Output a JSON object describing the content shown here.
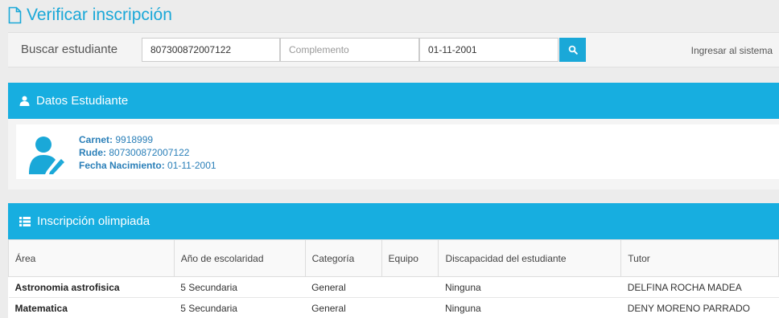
{
  "page": {
    "title": "Verificar inscripción"
  },
  "search": {
    "label": "Buscar estudiante",
    "ci_value": "807300872007122",
    "complement_placeholder": "Complemento",
    "date_value": "01-11-2001",
    "login_link": "Ingresar al sistema"
  },
  "student": {
    "panel_title": "Datos Estudiante",
    "carnet_label": "Carnet:",
    "carnet": "9918999",
    "rude_label": "Rude:",
    "rude": "807300872007122",
    "birth_label": "Fecha Nacimiento:",
    "birth": "01-11-2001"
  },
  "registration": {
    "panel_title": "Inscripción olimpiada",
    "columns": [
      "Área",
      "Año de escolaridad",
      "Categoría",
      "Equipo",
      "Discapacidad del estudiante",
      "Tutor"
    ],
    "rows": [
      {
        "area": "Astronomia astrofisica",
        "year": "5 Secundaria",
        "category": "General",
        "team": "",
        "disability": "Ninguna",
        "tutor": "DELFINA ROCHA MADEA"
      },
      {
        "area": "Matematica",
        "year": "5 Secundaria",
        "category": "General",
        "team": "",
        "disability": "Ninguna",
        "tutor": "DENY MORENO PARRADO"
      }
    ]
  },
  "colors": {
    "accent": "#17aee0",
    "title": "#1aa8d8",
    "info_text": "#2a7fb8"
  },
  "icons": {
    "title": "document-icon",
    "search": "search-icon",
    "student": "user-icon",
    "avatar": "student-avatar-icon",
    "list": "list-icon"
  }
}
